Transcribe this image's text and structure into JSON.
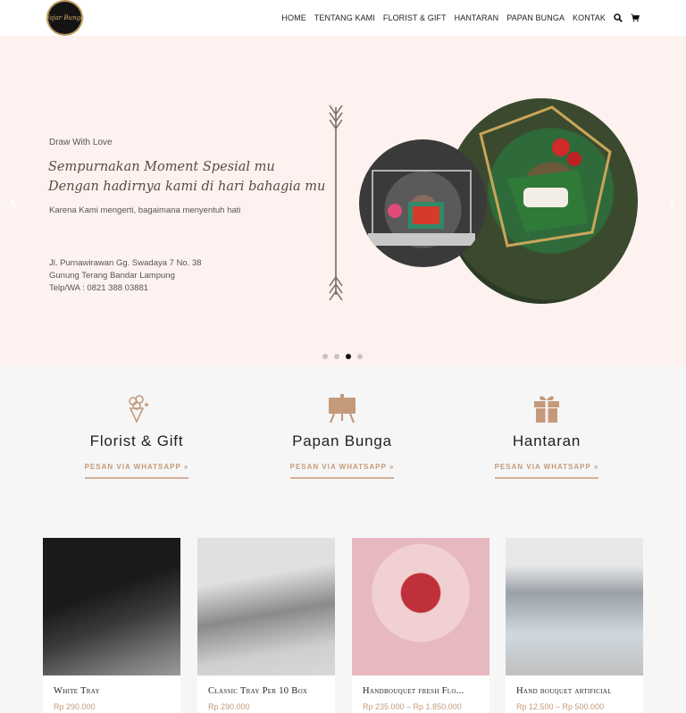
{
  "brand": {
    "logo_text": "Fajar Bunga"
  },
  "nav": {
    "items": [
      "HOME",
      "TENTANG KAMI",
      "FLORIST & GIFT",
      "HANTARAN",
      "PAPAN BUNGA",
      "KONTAK"
    ],
    "icons": [
      "search-icon",
      "cart-icon"
    ]
  },
  "hero": {
    "eyebrow": "Draw With Love",
    "script_line1": "Sempurnakan Moment Spesial mu",
    "script_line2": "Dengan hadirnya kami di hari bahagia mu",
    "subtitle": "Karena Kami mengerti, bagaimana menyentuh hati",
    "address_line1": "Jl. Purnawirawan Gg. Swadaya 7 No. 38",
    "address_line2": "Gunung Terang Bandar Lampung",
    "address_line3": "Telp/WA : 0821 388 03881",
    "slides": 4,
    "active_slide": 3
  },
  "services": [
    {
      "title": "Florist & Gift",
      "cta": "PESAN VIA WHATSAPP  »",
      "icon": "bouquet-icon"
    },
    {
      "title": "Papan Bunga",
      "cta": "PESAN VIA WHATSAPP  »",
      "icon": "easel-board-icon"
    },
    {
      "title": "Hantaran",
      "cta": "PESAN VIA WHATSAPP  »",
      "icon": "gift-icon"
    }
  ],
  "products": [
    {
      "name": "White Tray",
      "price": "Rp 290.000"
    },
    {
      "name": "Classic Tray Per 10 Box",
      "price": "Rp 290.000"
    },
    {
      "name": "Handbouquet fresh Flo...",
      "price": "Rp 235.000 – Rp 1.850.000"
    },
    {
      "name": "Hand bouquet artificial",
      "price": "Rp 12.500 – Rp 500.000"
    }
  ],
  "colors": {
    "accent": "#c49a7a",
    "hero_bg": "#fdf2ef",
    "page_bg": "#f6f6f6"
  }
}
